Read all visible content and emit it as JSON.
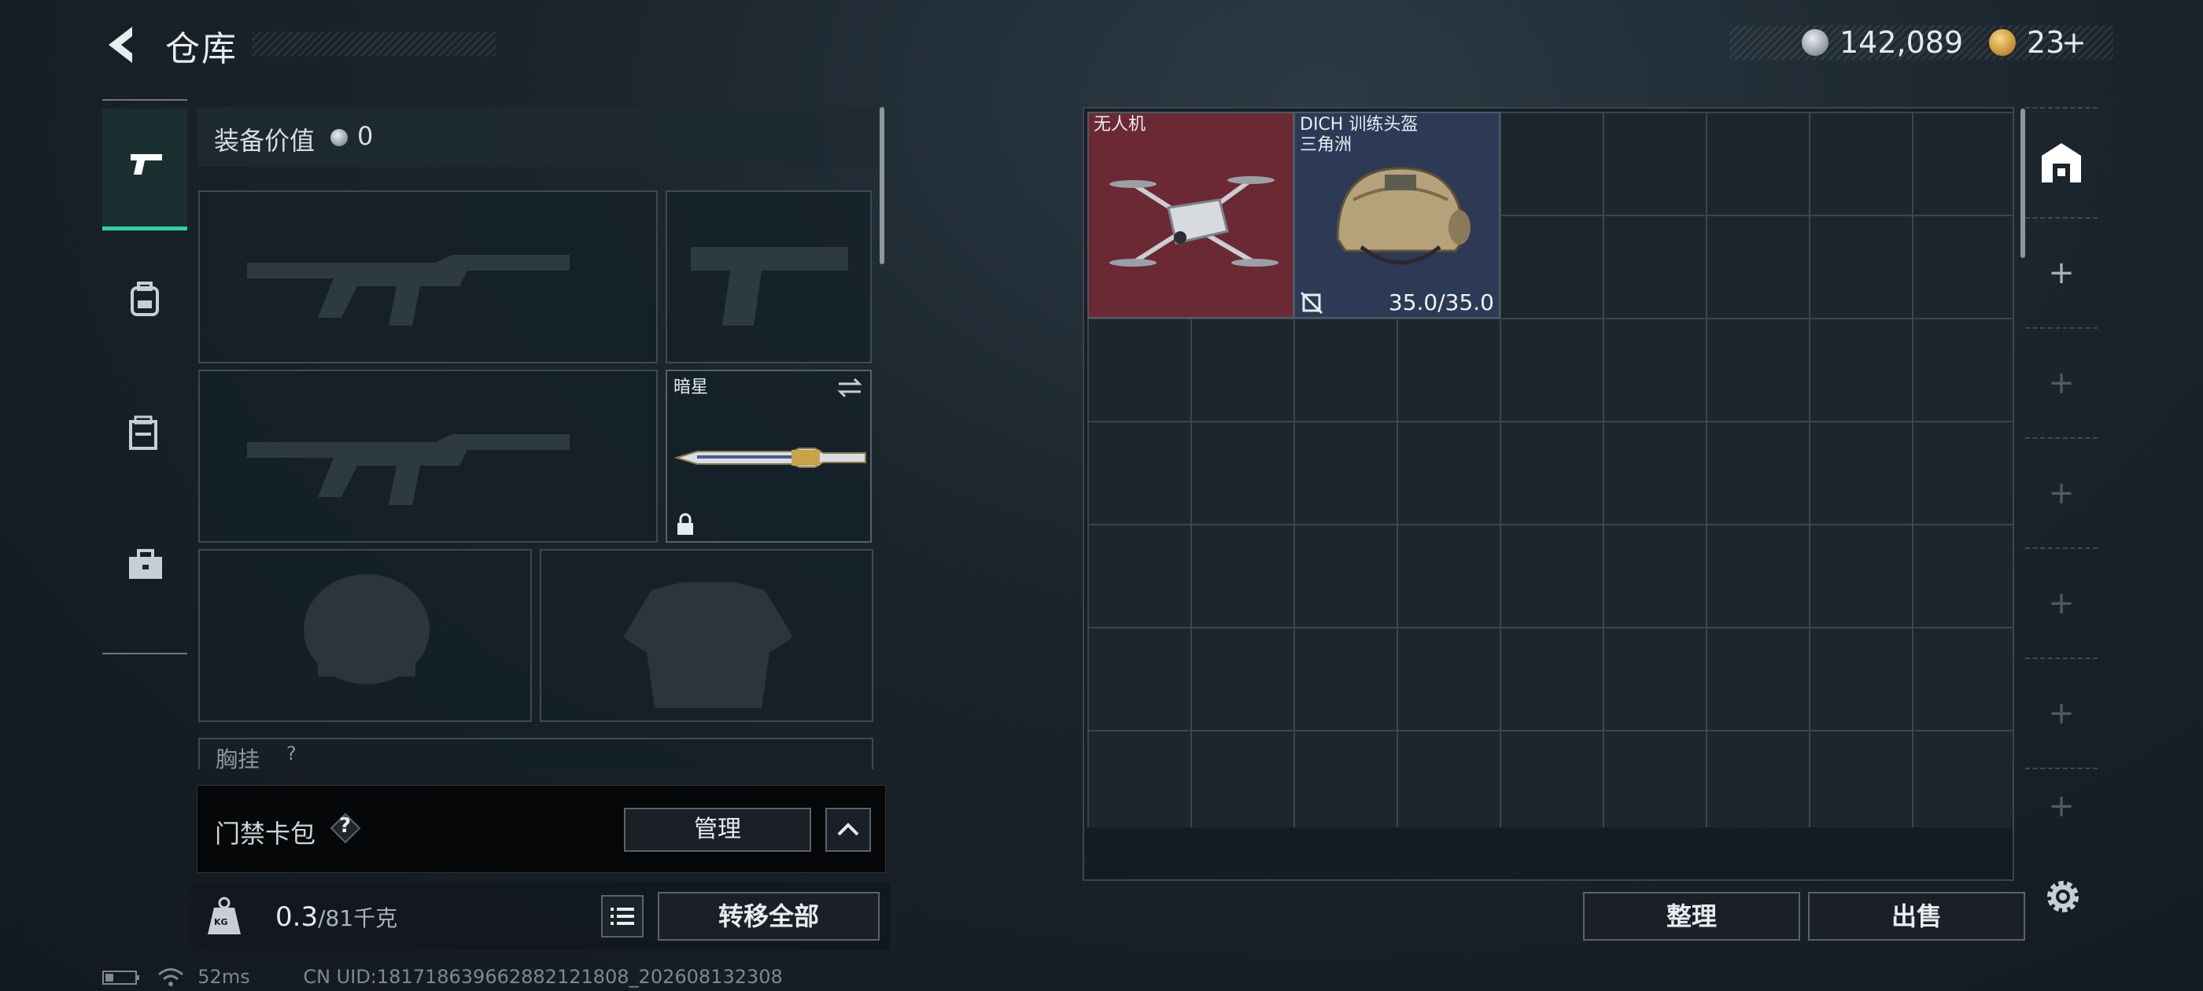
{
  "header": {
    "title": "仓库",
    "silver_amount": "142,089",
    "gold_amount": "23",
    "gold_plus": "+"
  },
  "nav": {
    "items": [
      "weapons",
      "backpack",
      "armor-vest",
      "toolbox"
    ]
  },
  "equipment": {
    "value_label": "装备价值",
    "value": "0",
    "melee_name": "暗星",
    "chest_rig_label": "胸挂",
    "chest_rig_help": "?"
  },
  "card_pack": {
    "label": "门禁卡包",
    "help": "?",
    "manage_label": "管理"
  },
  "weight": {
    "current": "0.3",
    "max": "/81",
    "unit": "千克",
    "kg_icon_text": "KG"
  },
  "transfer_all_label": "转移全部",
  "stash": {
    "items": [
      {
        "name": "无人机",
        "durability": ""
      },
      {
        "name": "DICH 训练头盔",
        "subtitle": "三角洲",
        "durability": "35.0/35.0"
      }
    ],
    "sort_label": "整理",
    "sell_label": "出售"
  },
  "rail": {
    "add_symbol": "+"
  },
  "status": {
    "ping": "52ms",
    "uid": "CN UID:18171863966288212180‌8_202608132308"
  },
  "colors": {
    "accent_green": "#2fd3a4",
    "drone_bg": "#6b2a33",
    "helmet_bg": "#2c3a55"
  }
}
